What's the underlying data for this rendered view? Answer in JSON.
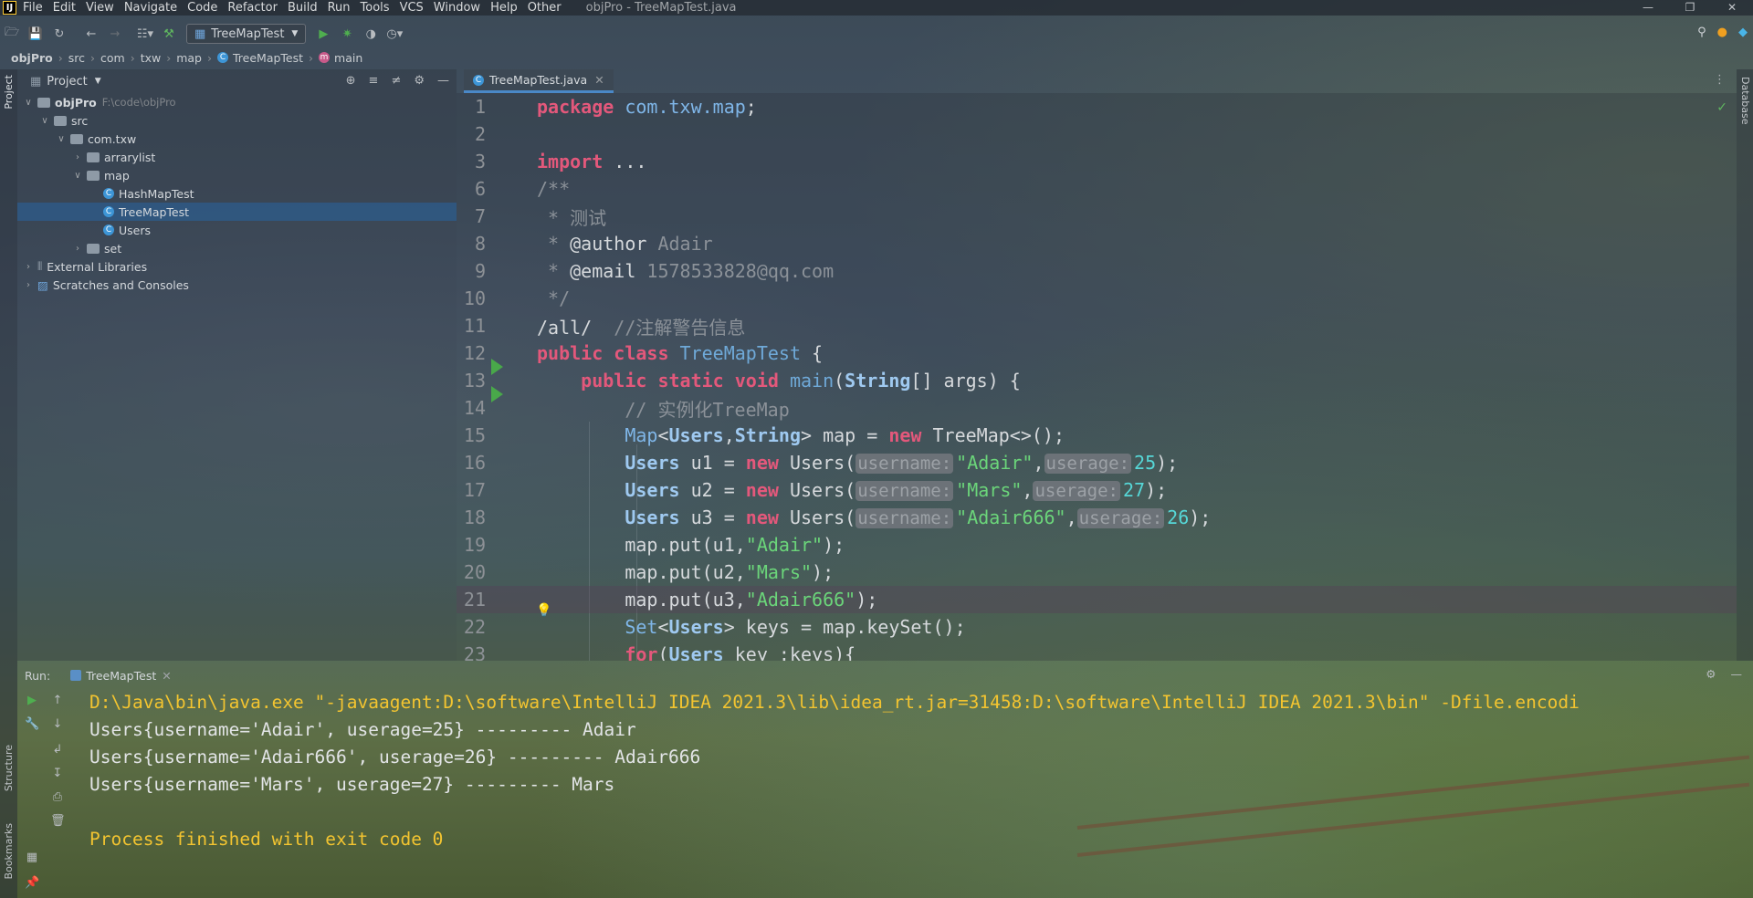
{
  "menubar": {
    "logo": "IJ",
    "items": [
      "File",
      "Edit",
      "View",
      "Navigate",
      "Code",
      "Refactor",
      "Build",
      "Run",
      "Tools",
      "VCS",
      "Window",
      "Help",
      "Other"
    ],
    "window_title": "objPro - TreeMapTest.java"
  },
  "toolbar": {
    "run_config": "TreeMapTest"
  },
  "breadcrumb": [
    "objPro",
    "src",
    "com",
    "txw",
    "map",
    "TreeMapTest",
    "main"
  ],
  "left_strip": {
    "project": "Project",
    "structure": "Structure",
    "bookmarks": "Bookmarks"
  },
  "right_strip": {
    "database": "Database"
  },
  "project_panel": {
    "title": "Project",
    "tree": [
      {
        "label": "objPro",
        "hint": "F:\\code\\objPro",
        "level": 0,
        "arrow": "v",
        "kind": "module",
        "selected": false
      },
      {
        "label": "src",
        "hint": "",
        "level": 1,
        "arrow": "v",
        "kind": "folder",
        "selected": false
      },
      {
        "label": "com.txw",
        "hint": "",
        "level": 2,
        "arrow": "v",
        "kind": "folder",
        "selected": false
      },
      {
        "label": "arrarylist",
        "hint": "",
        "level": 3,
        "arrow": ">",
        "kind": "folder",
        "selected": false
      },
      {
        "label": "map",
        "hint": "",
        "level": 3,
        "arrow": "v",
        "kind": "folder",
        "selected": false
      },
      {
        "label": "HashMapTest",
        "hint": "",
        "level": 4,
        "arrow": "",
        "kind": "class",
        "selected": false
      },
      {
        "label": "TreeMapTest",
        "hint": "",
        "level": 4,
        "arrow": "",
        "kind": "class",
        "selected": true
      },
      {
        "label": "Users",
        "hint": "",
        "level": 4,
        "arrow": "",
        "kind": "class",
        "selected": false
      },
      {
        "label": "set",
        "hint": "",
        "level": 3,
        "arrow": ">",
        "kind": "folder",
        "selected": false
      },
      {
        "label": "External Libraries",
        "hint": "",
        "level": 0,
        "arrow": ">",
        "kind": "library",
        "selected": false
      },
      {
        "label": "Scratches and Consoles",
        "hint": "",
        "level": 0,
        "arrow": ">",
        "kind": "scratch",
        "selected": false
      }
    ]
  },
  "editor": {
    "tab_label": "TreeMapTest.java",
    "lines": [
      {
        "n": "1",
        "tokens": [
          [
            "kw",
            "package "
          ],
          [
            "ty",
            "com.txw.map"
          ],
          [
            "code",
            ";"
          ]
        ]
      },
      {
        "n": "2",
        "tokens": []
      },
      {
        "n": "3",
        "tokens": [
          [
            "kw",
            "import "
          ],
          [
            "code",
            "..."
          ]
        ]
      },
      {
        "n": "6",
        "tokens": [
          [
            "cm",
            "/**"
          ]
        ]
      },
      {
        "n": "7",
        "tokens": [
          [
            "cm",
            " * 测试"
          ]
        ]
      },
      {
        "n": "8",
        "tokens": [
          [
            "cm",
            " * "
          ],
          [
            "code",
            "@author "
          ],
          [
            "cm",
            "Adair"
          ]
        ]
      },
      {
        "n": "9",
        "tokens": [
          [
            "cm",
            " * "
          ],
          [
            "code",
            "@email "
          ],
          [
            "cm",
            "1578533828@qq.com"
          ]
        ]
      },
      {
        "n": "10",
        "tokens": [
          [
            "cm",
            " */"
          ]
        ]
      },
      {
        "n": "11",
        "tokens": [
          [
            "code",
            "/all/  "
          ],
          [
            "cm",
            "//注解警告信息"
          ]
        ]
      },
      {
        "n": "12",
        "tokens": [
          [
            "kw",
            "public class "
          ],
          [
            "fn",
            "TreeMapTest "
          ],
          [
            "code",
            "{"
          ]
        ]
      },
      {
        "n": "13",
        "tokens": [
          [
            "code",
            "    "
          ],
          [
            "kw",
            "public static void "
          ],
          [
            "fn",
            "main"
          ],
          [
            "code",
            "("
          ],
          [
            "typ",
            "String"
          ],
          [
            "code",
            "[] args) {"
          ]
        ]
      },
      {
        "n": "14",
        "tokens": [
          [
            "code",
            "        "
          ],
          [
            "cm",
            "// 实例化TreeMap"
          ]
        ]
      },
      {
        "n": "15",
        "tokens": [
          [
            "code",
            "        "
          ],
          [
            "ty",
            "Map"
          ],
          [
            "code",
            "<"
          ],
          [
            "typ",
            "Users"
          ],
          [
            "code",
            ","
          ],
          [
            "typ",
            "String"
          ],
          [
            "code",
            "> map = "
          ],
          [
            "kw",
            "new "
          ],
          [
            "code",
            "TreeMap<>();"
          ]
        ]
      },
      {
        "n": "16",
        "tokens": [
          [
            "code",
            "        "
          ],
          [
            "typ",
            "Users "
          ],
          [
            "code",
            "u1 = "
          ],
          [
            "kw",
            "new "
          ],
          [
            "code",
            "Users("
          ],
          [
            "hint",
            "username:"
          ],
          [
            "str",
            "\"Adair\""
          ],
          [
            "code",
            ","
          ],
          [
            "hint",
            "userage:"
          ],
          [
            "num",
            "25"
          ],
          [
            "code",
            ");"
          ]
        ]
      },
      {
        "n": "17",
        "tokens": [
          [
            "code",
            "        "
          ],
          [
            "typ",
            "Users "
          ],
          [
            "code",
            "u2 = "
          ],
          [
            "kw",
            "new "
          ],
          [
            "code",
            "Users("
          ],
          [
            "hint",
            "username:"
          ],
          [
            "str",
            "\"Mars\""
          ],
          [
            "code",
            ","
          ],
          [
            "hint",
            "userage:"
          ],
          [
            "num",
            "27"
          ],
          [
            "code",
            ");"
          ]
        ]
      },
      {
        "n": "18",
        "tokens": [
          [
            "code",
            "        "
          ],
          [
            "typ",
            "Users "
          ],
          [
            "code",
            "u3 = "
          ],
          [
            "kw",
            "new "
          ],
          [
            "code",
            "Users("
          ],
          [
            "hint",
            "username:"
          ],
          [
            "str",
            "\"Adair666\""
          ],
          [
            "code",
            ","
          ],
          [
            "hint",
            "userage:"
          ],
          [
            "num",
            "26"
          ],
          [
            "code",
            ");"
          ]
        ]
      },
      {
        "n": "19",
        "tokens": [
          [
            "code",
            "        map.put(u1,"
          ],
          [
            "str",
            "\"Adair\""
          ],
          [
            "code",
            ");"
          ]
        ]
      },
      {
        "n": "20",
        "tokens": [
          [
            "code",
            "        map.put(u2,"
          ],
          [
            "str",
            "\"Mars\""
          ],
          [
            "code",
            ");"
          ]
        ]
      },
      {
        "n": "21",
        "tokens": [
          [
            "code",
            "        map.put(u3,"
          ],
          [
            "str",
            "\"Adair666\""
          ],
          [
            "code",
            ");"
          ]
        ]
      },
      {
        "n": "22",
        "tokens": [
          [
            "code",
            "        "
          ],
          [
            "ty",
            "Set"
          ],
          [
            "code",
            "<"
          ],
          [
            "typ",
            "Users"
          ],
          [
            "code",
            "> keys = map.keySet();"
          ]
        ]
      },
      {
        "n": "23",
        "tokens": [
          [
            "code",
            "        "
          ],
          [
            "kw",
            "for"
          ],
          [
            "code",
            "("
          ],
          [
            "typ",
            "Users "
          ],
          [
            "code",
            "key :keys){"
          ]
        ]
      }
    ]
  },
  "run_panel": {
    "label": "Run:",
    "tab_label": "TreeMapTest",
    "output": [
      {
        "text": "D:\\Java\\bin\\java.exe \"-javaagent:D:\\software\\IntelliJ IDEA 2021.3\\lib\\idea_rt.jar=31458:D:\\software\\IntelliJ IDEA 2021.3\\bin\" -Dfile.encodi",
        "color": "yellow"
      },
      {
        "text": "Users{username='Adair', userage=25} --------- Adair",
        "color": "white"
      },
      {
        "text": "Users{username='Adair666', userage=26} --------- Adair666",
        "color": "white"
      },
      {
        "text": "Users{username='Mars', userage=27} --------- Mars",
        "color": "white"
      },
      {
        "text": "",
        "color": "white"
      },
      {
        "text": "Process finished with exit code 0",
        "color": "yellow"
      }
    ]
  },
  "colors": {
    "keyword": "#e3587b",
    "string": "#6bd57a",
    "number": "#56d7d7",
    "comment": "#8b9198",
    "console_yellow": "#f3c430",
    "selection": "#2e5c8c"
  }
}
